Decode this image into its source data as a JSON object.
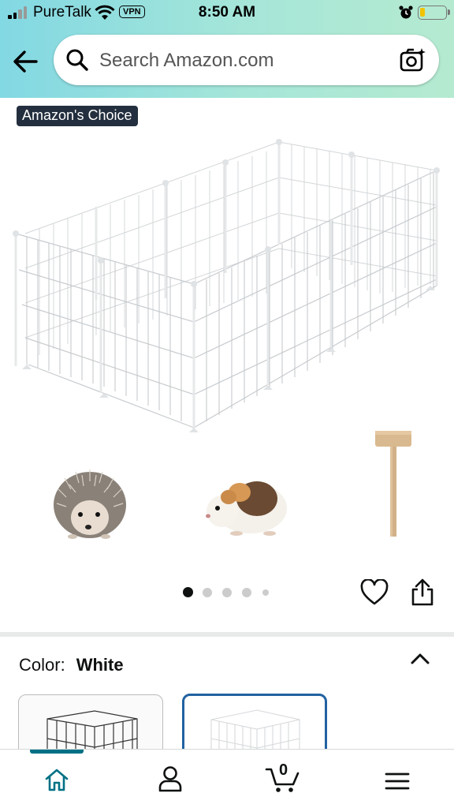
{
  "status_bar": {
    "carrier": "PureTalk",
    "vpn": "VPN",
    "time": "8:50 AM",
    "battery_color": "#f2c400"
  },
  "header": {
    "back_icon": "arrow-left-icon",
    "search_placeholder": "Search Amazon.com",
    "camera_icon": "camera-search-icon"
  },
  "product": {
    "badge": "Amazon's Choice",
    "image_description_icons": [
      "playpen-cage",
      "hedgehog",
      "guinea-pig",
      "wooden-mallet"
    ],
    "carousel": {
      "count": 5,
      "active_index": 0
    }
  },
  "variation": {
    "label": "Color:",
    "value": "White",
    "options": [
      "black-cage",
      "white-cage"
    ],
    "selected_index": 1
  },
  "tabbar": {
    "items": [
      "home-icon",
      "account-icon",
      "cart-icon",
      "menu-icon"
    ],
    "active_index": 0,
    "cart_count": "0",
    "accent": "#007185"
  }
}
